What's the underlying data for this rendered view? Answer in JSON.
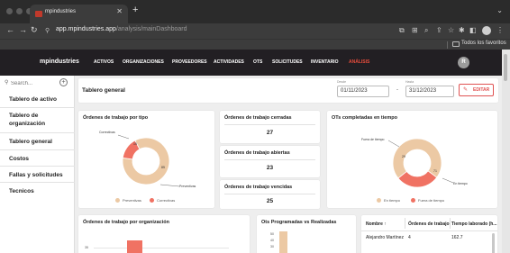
{
  "browser": {
    "tab_title": "mpindustries",
    "new_tab_symbol": "+",
    "url_host": "app.mpindustries.app",
    "url_path": "/analysis/mainDashboard",
    "favorites_label": "Todos los favoritos"
  },
  "app": {
    "logo": "mpindustries",
    "nav": [
      "ACTIVOS",
      "ORGANIZACIONES",
      "PROVEEDORES",
      "ACTIVIDADES",
      "OTS",
      "SOLICITUDES",
      "INVENTARIO",
      "ANÁLISIS"
    ],
    "active_nav": "ANÁLISIS",
    "avatar_initial": "R",
    "accent": "#e74c3c"
  },
  "sidebar": {
    "search_placeholder": "Search...",
    "items": [
      "Tablero de activo",
      "Tablero de organización",
      "Tablero general",
      "Costos",
      "Fallas y solicitudes",
      "Tecnicos"
    ],
    "active": "Tablero general"
  },
  "header": {
    "title": "Tablero general",
    "from_label": "Desde",
    "from_value": "01/11/2023",
    "range_sep": "-",
    "to_label": "Hasta",
    "to_value": "31/12/2023",
    "edit_label": "EDITAR"
  },
  "ot_tipo": {
    "title": "Órdenes de trabajo por tipo",
    "legend": [
      "Preventivas",
      "Correctivas"
    ],
    "annotations": [
      "Correctivas",
      "Preventivas"
    ],
    "slice_labels": [
      "15",
      "85"
    ]
  },
  "metrics": [
    {
      "title": "Órdenes de trabajo cerradas",
      "value": "27"
    },
    {
      "title": "Órdenes de trabajo abiertas",
      "value": "23"
    },
    {
      "title": "Órdenes de trabajo vencidas",
      "value": "25"
    }
  ],
  "ots_tiempo": {
    "title": "OTs completadas en tiempo",
    "legend": [
      "En tiempo",
      "Fuera de tiempo"
    ],
    "annotations": [
      "Fuera de tiempo",
      "En tiempo"
    ],
    "slice_labels": [
      "29",
      "71"
    ]
  },
  "ot_org": {
    "title": "Órdenes de trabajo por organización",
    "tick": "35"
  },
  "ots_prog": {
    "title": "Ots Programadas vs Realizadas",
    "ticks": [
      "50",
      "40",
      "30"
    ]
  },
  "table": {
    "headers": [
      "Nombre ↑",
      "Órdenes de trabajo",
      "Tiempo laborado (h..."
    ],
    "rows": [
      {
        "name": "Alejandro Martínez",
        "orders": "4",
        "hours": "162.7"
      }
    ]
  },
  "chart_data": [
    {
      "type": "pie",
      "title": "Órdenes de trabajo por tipo",
      "labels": [
        "Preventivas",
        "Correctivas"
      ],
      "values": [
        85,
        15
      ],
      "colors": [
        "#ecc9a4",
        "#f07263"
      ],
      "legend": "bottom"
    },
    {
      "type": "pie",
      "title": "OTs completadas en tiempo",
      "labels": [
        "En tiempo",
        "Fuera de tiempo"
      ],
      "values": [
        71,
        29
      ],
      "colors": [
        "#ecc9a4",
        "#f07263"
      ],
      "legend": "bottom"
    }
  ]
}
